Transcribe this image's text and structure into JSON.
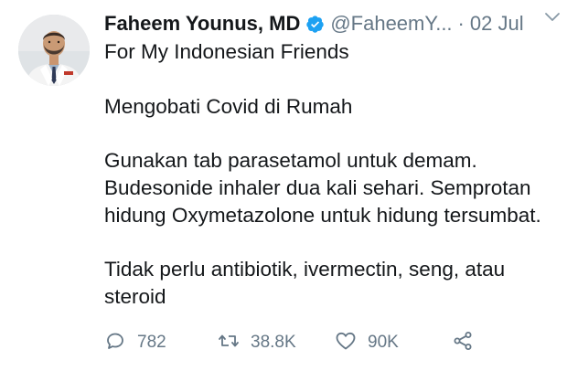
{
  "tweet": {
    "display_name": "Faheem Younus, MD",
    "handle": "@FaheemY...",
    "separator": "·",
    "date": "02 Jul",
    "lines": [
      "For My Indonesian Friends",
      "",
      "Mengobati Covid di Rumah",
      "",
      "Gunakan tab parasetamol untuk demam.",
      "Budesonide inhaler dua kali sehari. Semprotan",
      "hidung Oxymetazolone untuk hidung tersumbat.",
      "",
      "Tidak perlu antibiotik, ivermectin, seng, atau",
      "steroid"
    ]
  },
  "actions": {
    "reply_count": "782",
    "retweet_count": "38.8K",
    "like_count": "90K"
  },
  "icons": {
    "verified": "verified-badge-icon",
    "chevron": "chevron-down-icon",
    "reply": "reply-icon",
    "retweet": "retweet-icon",
    "like": "heart-icon",
    "share": "share-icon"
  },
  "colors": {
    "text": "#14171a",
    "muted": "#657786",
    "verified": "#1da1f2"
  }
}
